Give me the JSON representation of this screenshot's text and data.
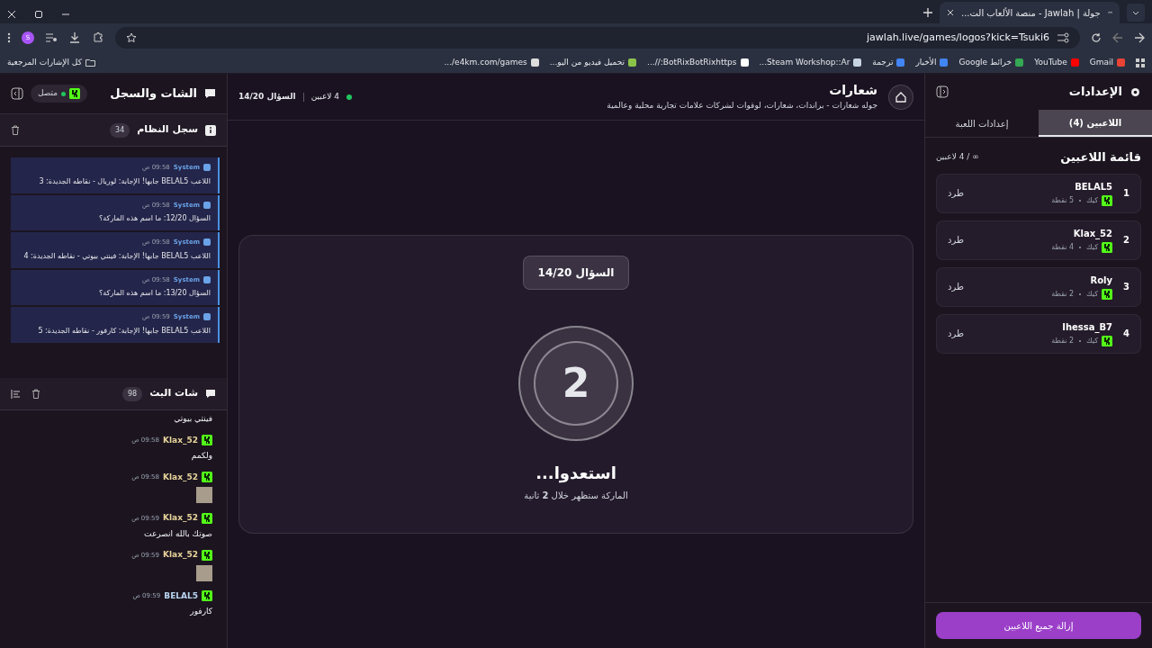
{
  "browser": {
    "tab_title": "جولة | Jawlah - منصة الألعاب الت...",
    "profile_initial": "S",
    "url": "jawlah.live/games/logos?kick=Tsuki6",
    "bookmarks": [
      "Gmail",
      "YouTube",
      "خرائط Google",
      "الأخبار",
      "ترجمة",
      "Steam Workshop::Ar...",
      "BotRixBotRixhttps://...",
      "تحميل فيديو من اليو...",
      "e4km.com/games/..."
    ],
    "all_bookmarks": "كل الإشارات المرجعية"
  },
  "settings_panel": {
    "title": "الإعدادات",
    "tabs": [
      {
        "label": "اللاعبين (4)",
        "selected": true
      },
      {
        "label": "إعدادات اللعبة",
        "selected": false
      }
    ],
    "list_title": "قائمة اللاعبين",
    "list_count": "∞ / 4 لاعبين",
    "players": [
      {
        "rank": "1",
        "name": "BELAL5",
        "platform": "كيك",
        "points": "5 نقطة",
        "kick_label": "طرد"
      },
      {
        "rank": "2",
        "name": "Klax_52",
        "platform": "كيك",
        "points": "4 نقطة",
        "kick_label": "طرد"
      },
      {
        "rank": "3",
        "name": "Roly",
        "platform": "كيك",
        "points": "2 نقطة",
        "kick_label": "طرد"
      },
      {
        "rank": "4",
        "name": "Ihessa_B7",
        "platform": "كيك",
        "points": "2 نقطة",
        "kick_label": "طرد"
      }
    ],
    "remove_all": "إزالة جميع اللاعبين"
  },
  "game": {
    "title": "شعارات",
    "description": "جوله شعارات - براندات، شعارات، لوقوات لشركات علامات تجارية محلية وعالمية",
    "players_count": "4 لاعبين",
    "question": "السؤال 14/20",
    "card": {
      "badge": "السؤال 14/20",
      "countdown": "2",
      "heading": "استعدوا...",
      "subtitle": "الماركة ستظهر خلال **2** ثانية"
    }
  },
  "chat_panel": {
    "title": "الشات والسجل",
    "status": "متصل",
    "system_log": {
      "title": "سجل النظام",
      "count": "34",
      "entries": [
        {
          "sender": "System",
          "time": "09:58 ص",
          "text": "اللاعب BELAL5 جابها! الإجابة: لوريال - نقاطه الجديدة: 3"
        },
        {
          "sender": "System",
          "time": "09:58 ص",
          "text": "السؤال 12/20: ما اسم هذه الماركة؟"
        },
        {
          "sender": "System",
          "time": "09:58 ص",
          "text": "اللاعب BELAL5 جابها! الإجابة: فينتي بيوتي - نقاطه الجديدة: 4"
        },
        {
          "sender": "System",
          "time": "09:58 ص",
          "text": "السؤال 13/20: ما اسم هذه الماركة؟"
        },
        {
          "sender": "System",
          "time": "09:59 ص",
          "text": "اللاعب BELAL5 جابها! الإجابة: كارفور - نقاطه الجديدة: 5"
        }
      ]
    },
    "stream_chat": {
      "title": "شات البث",
      "count": "98",
      "messages": [
        {
          "kind": "text",
          "text": "فينتي بيوتي"
        },
        {
          "kind": "text",
          "user": "Klax_52",
          "color": "#e8d49a",
          "time": "09:58 ص",
          "text": "ولكمم"
        },
        {
          "kind": "image",
          "user": "Klax_52",
          "color": "#e8d49a",
          "time": "09:58 ص"
        },
        {
          "kind": "text",
          "user": "Klax_52",
          "color": "#e8d49a",
          "time": "09:59 ص",
          "text": "صوتك بالله انصرعت"
        },
        {
          "kind": "image",
          "user": "Klax_52",
          "color": "#e8d49a",
          "time": "09:59 ص"
        },
        {
          "kind": "text",
          "user": "BELAL5",
          "color": "#b9d4f0",
          "time": "09:59 ص",
          "text": "كارفور"
        }
      ]
    }
  }
}
